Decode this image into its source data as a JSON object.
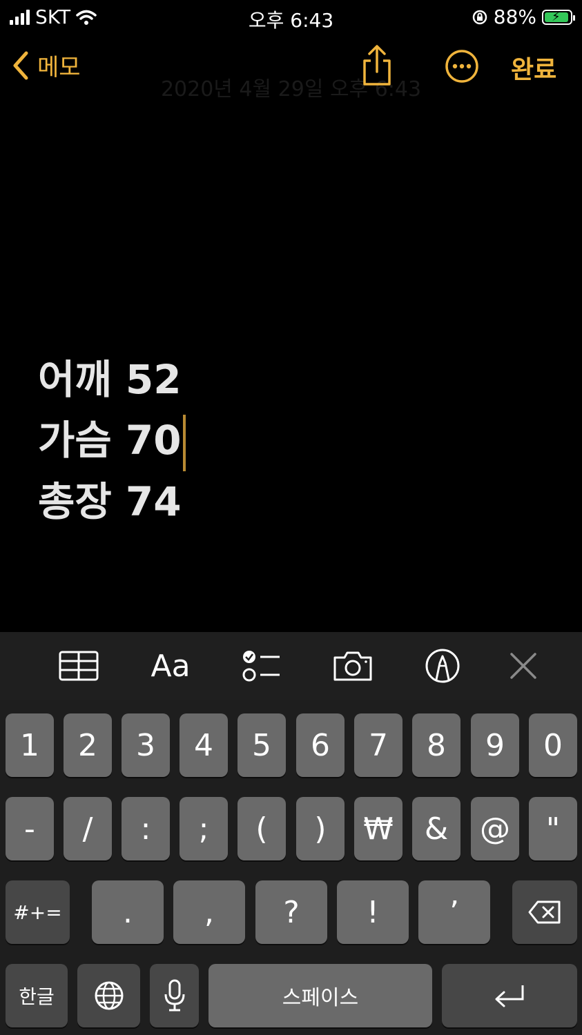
{
  "status": {
    "carrier": "SKT",
    "time": "오후 6:43",
    "battery": "88%",
    "battery_level": 0.88
  },
  "nav": {
    "back_label": "메모",
    "date_text": "2020년 4월 29일 오후 6:43",
    "done_label": "완료"
  },
  "note": {
    "lines": [
      "어깨 52",
      "가슴 70",
      "총장 74"
    ]
  },
  "toolbar": {
    "text_style_label": "Aa"
  },
  "keyboard": {
    "row1": [
      "1",
      "2",
      "3",
      "4",
      "5",
      "6",
      "7",
      "8",
      "9",
      "0"
    ],
    "row2": [
      "-",
      "/",
      ":",
      ";",
      "(",
      ")",
      "₩",
      "&",
      "@",
      "\""
    ],
    "row3": {
      "shift_label": "#+=",
      "keys": [
        ".",
        ",",
        "?",
        "!",
        "’"
      ]
    },
    "row4": {
      "lang_label": "한글",
      "space_label": "스페이스"
    }
  },
  "colors": {
    "accent": "#f0b43c",
    "background": "#000000",
    "key": "#6a6a6a",
    "key_dark": "#474747",
    "battery": "#34c759"
  }
}
